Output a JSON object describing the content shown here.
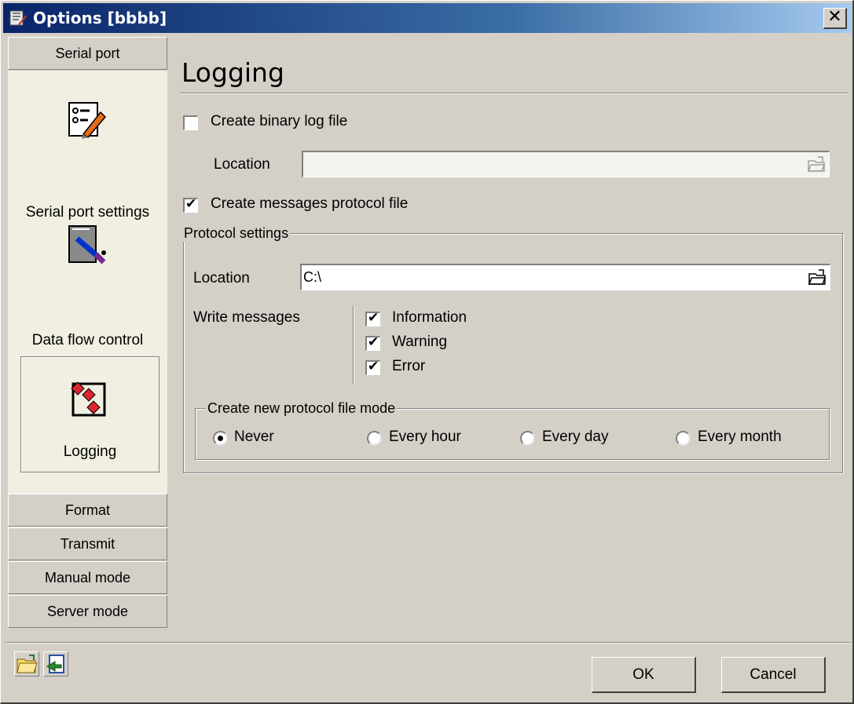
{
  "window": {
    "title": "Options [bbbb]",
    "close_glyph": "✕"
  },
  "sidebar": {
    "top_header": "Serial port",
    "items": [
      {
        "label": "Serial port settings",
        "icon": "settings-list-icon"
      },
      {
        "label": "Data flow control",
        "icon": "data-flow-icon"
      },
      {
        "label": "Logging",
        "icon": "logging-icon",
        "selected": true
      }
    ],
    "bottom_headers": [
      "Format",
      "Transmit",
      "Manual mode",
      "Server mode"
    ]
  },
  "main": {
    "title": "Logging",
    "binary_log": {
      "label": "Create binary log file",
      "checked": false,
      "location_label": "Location",
      "location_value": ""
    },
    "protocol_file": {
      "label": "Create messages protocol file",
      "checked": true
    },
    "protocol_settings": {
      "caption": "Protocol settings",
      "location_label": "Location",
      "location_value": "C:\\",
      "write_messages_label": "Write messages",
      "messages": [
        {
          "label": "Information",
          "checked": true
        },
        {
          "label": "Warning",
          "checked": true
        },
        {
          "label": "Error",
          "checked": true
        }
      ],
      "mode": {
        "caption": "Create new protocol file mode",
        "options": [
          "Never",
          "Every hour",
          "Every day",
          "Every month"
        ],
        "selected": "Never"
      }
    }
  },
  "footer": {
    "tools": [
      "open-folder-icon",
      "export-icon"
    ],
    "ok_label": "OK",
    "cancel_label": "Cancel"
  },
  "colors": {
    "face": "#d4d0c8",
    "sidebar_panel": "#f1efe2",
    "title_start": "#0a246a",
    "title_end": "#a6caf0"
  }
}
